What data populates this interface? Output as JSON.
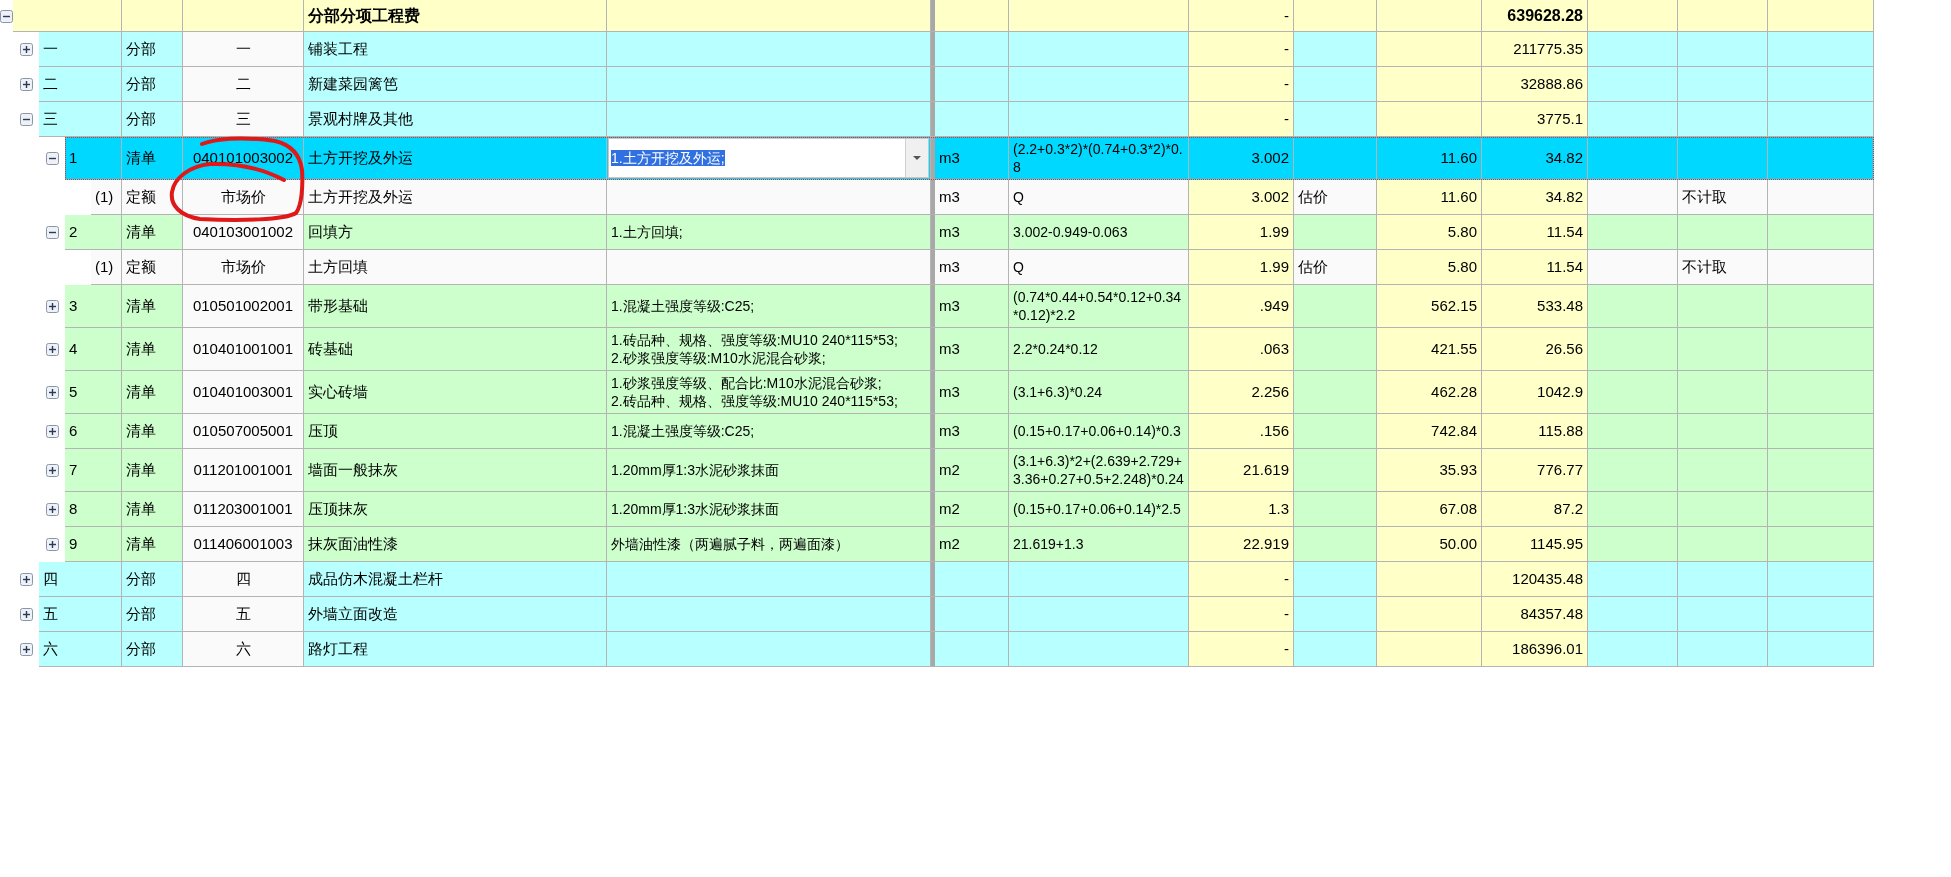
{
  "table": {
    "rows": [
      {
        "kind": "total",
        "selected": false,
        "expanded": true,
        "column_4": "分部分项工程费",
        "column_8": "-",
        "column_11": "639628.28",
        "children": [
          {
            "kind": "section",
            "selected": false,
            "expanded": false,
            "column_1": "一",
            "column_2": "分部",
            "column_3": "一",
            "column_4": "铺装工程",
            "column_8": "-",
            "column_11": "211775.35"
          },
          {
            "kind": "section",
            "selected": false,
            "expanded": false,
            "column_1": "二",
            "column_2": "分部",
            "column_3": "二",
            "column_4": "新建菜园篱笆",
            "column_8": "-",
            "column_11": "32888.86"
          },
          {
            "kind": "section",
            "selected": false,
            "expanded": true,
            "column_1": "三",
            "column_2": "分部",
            "column_3": "三",
            "column_4": "景观村牌及其他",
            "column_8": "-",
            "column_11": "3775.1",
            "children": [
              {
                "kind": "item",
                "selected": true,
                "expanded": true,
                "column_1": "1",
                "column_2": "清单",
                "column_3": "040101003002",
                "column_4": "土方开挖及外运",
                "column_5": "1.土方开挖及外运;",
                "column_6": "m3",
                "column_7": "(2.2+0.3*2)*(0.74+0.3*2)*0.8",
                "column_8": "3.002",
                "column_10": "11.60",
                "column_11": "34.82",
                "children": [
                  {
                    "kind": "quota",
                    "selected": false,
                    "column_1": "(1)",
                    "column_2": "定额",
                    "column_3": "市场价",
                    "column_4": "土方开挖及外运",
                    "column_6": "m3",
                    "column_7": "Q",
                    "column_8": "3.002",
                    "column_9": "估价",
                    "column_10": "11.60",
                    "column_11": "34.82",
                    "column_13": "不计取"
                  }
                ]
              },
              {
                "kind": "item",
                "selected": false,
                "expanded": true,
                "column_1": "2",
                "column_2": "清单",
                "column_3": "040103001002",
                "column_4": "回填方",
                "column_5": "1.土方回填;",
                "column_6": "m3",
                "column_7": "3.002-0.949-0.063",
                "column_8": "1.99",
                "column_10": "5.80",
                "column_11": "11.54",
                "children": [
                  {
                    "kind": "quota",
                    "selected": false,
                    "column_1": "(1)",
                    "column_2": "定额",
                    "column_3": "市场价",
                    "column_4": "土方回填",
                    "column_6": "m3",
                    "column_7": "Q",
                    "column_8": "1.99",
                    "column_9": "估价",
                    "column_10": "5.80",
                    "column_11": "11.54",
                    "column_13": "不计取"
                  }
                ]
              },
              {
                "kind": "item",
                "selected": false,
                "expanded": false,
                "column_1": "3",
                "column_2": "清单",
                "column_3": "010501002001",
                "column_4": "带形基础",
                "column_5": "1.混凝土强度等级:C25;",
                "column_6": "m3",
                "column_7": "(0.74*0.44+0.54*0.12+0.34*0.12)*2.2",
                "column_8": ".949",
                "column_10": "562.15",
                "column_11": "533.48"
              },
              {
                "kind": "item",
                "selected": false,
                "expanded": false,
                "column_1": "4",
                "column_2": "清单",
                "column_3": "010401001001",
                "column_4": "砖基础",
                "column_5": "1.砖品种、规格、强度等级:MU10 240*115*53;\n2.砂浆强度等级:M10水泥混合砂浆;",
                "column_6": "m3",
                "column_7": "2.2*0.24*0.12",
                "column_8": ".063",
                "column_10": "421.55",
                "column_11": "26.56"
              },
              {
                "kind": "item",
                "selected": false,
                "expanded": false,
                "column_1": "5",
                "column_2": "清单",
                "column_3": "010401003001",
                "column_4": "实心砖墙",
                "column_5": "1.砂浆强度等级、配合比:M10水泥混合砂浆;\n2.砖品种、规格、强度等级:MU10 240*115*53;",
                "column_6": "m3",
                "column_7": "(3.1+6.3)*0.24",
                "column_8": "2.256",
                "column_10": "462.28",
                "column_11": "1042.9"
              },
              {
                "kind": "item",
                "selected": false,
                "expanded": false,
                "column_1": "6",
                "column_2": "清单",
                "column_3": "010507005001",
                "column_4": "压顶",
                "column_5": "1.混凝土强度等级:C25;",
                "column_6": "m3",
                "column_7": "(0.15+0.17+0.06+0.14)*0.3",
                "column_8": ".156",
                "column_10": "742.84",
                "column_11": "115.88"
              },
              {
                "kind": "item",
                "selected": false,
                "expanded": false,
                "column_1": "7",
                "column_2": "清单",
                "column_3": "011201001001",
                "column_4": "墙面一般抹灰",
                "column_5": "1.20mm厚1:3水泥砂浆抹面",
                "column_6": "m2",
                "column_7": "(3.1+6.3)*2+(2.639+2.729+3.36+0.27+0.5+2.248)*0.24",
                "column_8": "21.619",
                "column_10": "35.93",
                "column_11": "776.77"
              },
              {
                "kind": "item",
                "selected": false,
                "expanded": false,
                "column_1": "8",
                "column_2": "清单",
                "column_3": "011203001001",
                "column_4": "压顶抹灰",
                "column_5": "1.20mm厚1:3水泥砂浆抹面",
                "column_6": "m2",
                "column_7": "(0.15+0.17+0.06+0.14)*2.5",
                "column_8": "1.3",
                "column_10": "67.08",
                "column_11": "87.2"
              },
              {
                "kind": "item",
                "selected": false,
                "expanded": false,
                "column_1": "9",
                "column_2": "清单",
                "column_3": "011406001003",
                "column_4": "抹灰面油性漆",
                "column_5": "外墙油性漆（两遍腻子料，两遍面漆）",
                "column_6": "m2",
                "column_7": "21.619+1.3",
                "column_8": "22.919",
                "column_10": "50.00",
                "column_11": "1145.95"
              }
            ]
          },
          {
            "kind": "section",
            "selected": false,
            "expanded": false,
            "column_1": "四",
            "column_2": "分部",
            "column_3": "四",
            "column_4": "成品仿木混凝土栏杆",
            "column_8": "-",
            "column_11": "120435.48"
          },
          {
            "kind": "section",
            "selected": false,
            "expanded": false,
            "column_1": "五",
            "column_2": "分部",
            "column_3": "五",
            "column_4": "外墙立面改造",
            "column_8": "-",
            "column_11": "84357.48"
          },
          {
            "kind": "section",
            "selected": false,
            "expanded": false,
            "column_1": "六",
            "column_2": "分部",
            "column_3": "六",
            "column_4": "路灯工程",
            "column_8": "-",
            "column_11": "186396.01"
          }
        ]
      }
    ]
  }
}
